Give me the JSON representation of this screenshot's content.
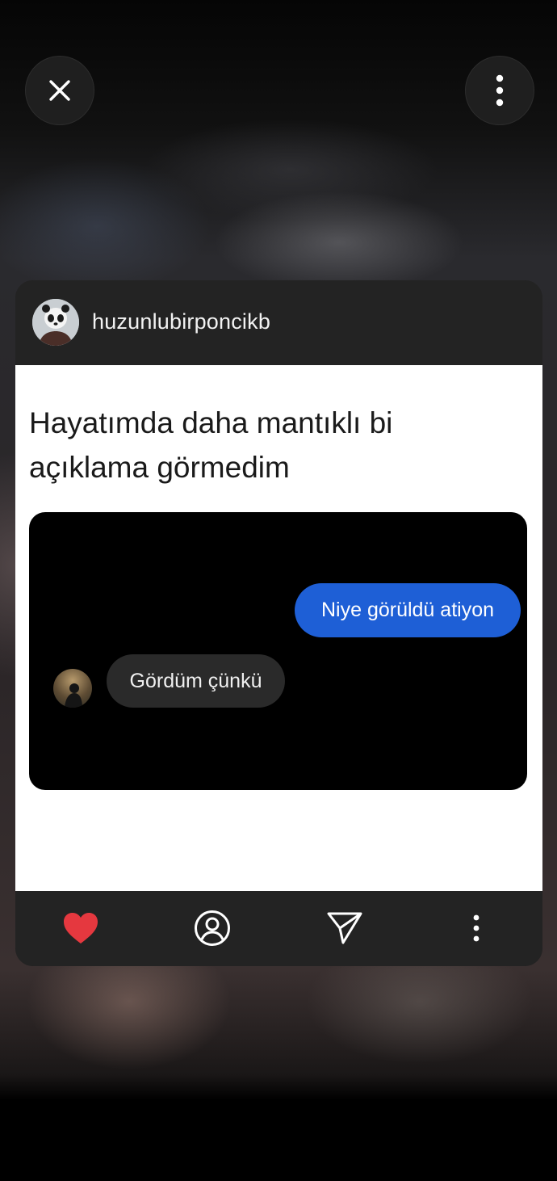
{
  "top_bar": {
    "close_icon": "close-icon",
    "more_icon": "more-vertical-icon"
  },
  "post": {
    "username": "huzunlubirponcikb",
    "avatar_icon": "panda-avatar",
    "caption": "Hayatımda daha mantıklı bi açıklama görmedim",
    "chat": {
      "outgoing_message": "Niye görüldü atiyon",
      "incoming_message": "Gördüm çünkü"
    }
  },
  "toolbar": {
    "like_icon": "heart-icon",
    "profile_icon": "profile-icon",
    "share_icon": "send-icon",
    "more_icon": "more-vertical-icon"
  },
  "colors": {
    "like": "#e5383f",
    "outgoing_bubble": "#1e5fd6",
    "incoming_bubble": "#2a2a2a",
    "card": "#232323"
  }
}
